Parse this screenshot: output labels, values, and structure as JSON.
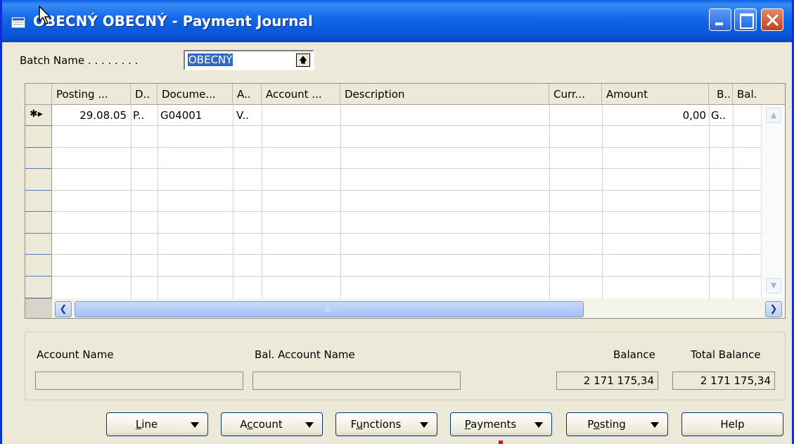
{
  "window": {
    "title": "OBECNÝ OBECNÝ - Payment Journal",
    "accent": "#0a54d6"
  },
  "batch": {
    "label": "Batch Name . . . . . . . .",
    "value": "OBECNÝ"
  },
  "grid": {
    "columns": [
      "Posting ...",
      "D..",
      "Docume...",
      "A..",
      "Account ...",
      "Description",
      "Curr...",
      "Amount",
      "B..",
      "Bal."
    ],
    "rows": [
      {
        "marker": "✱▸",
        "posting_date": "29.08.05",
        "document_type": "P..",
        "document_no": "G04001",
        "account_type": "V..",
        "account_no": "",
        "description": "",
        "currency": "",
        "amount": "0,00",
        "bal_type": "G..",
        "bal_account": ""
      }
    ],
    "empty_row_count": 9
  },
  "info": {
    "account_name_label": "Account Name",
    "bal_account_name_label": "Bal. Account Name",
    "balance_label": "Balance",
    "total_balance_label": "Total Balance",
    "account_name_value": "",
    "bal_account_name_value": "",
    "balance_value": "2 171 175,34",
    "total_balance_value": "2 171 175,34"
  },
  "buttons": {
    "line": {
      "pre": "",
      "u": "L",
      "post": "ine"
    },
    "account": {
      "pre": "A",
      "u": "c",
      "post": "count"
    },
    "functions": {
      "pre": "F",
      "u": "u",
      "post": "nctions"
    },
    "payments": {
      "pre": "",
      "u": "P",
      "post": "ayments"
    },
    "posting": {
      "pre": "P",
      "u": "o",
      "post": "sting"
    },
    "help": {
      "pre": "",
      "u": "",
      "post": "Help"
    }
  }
}
